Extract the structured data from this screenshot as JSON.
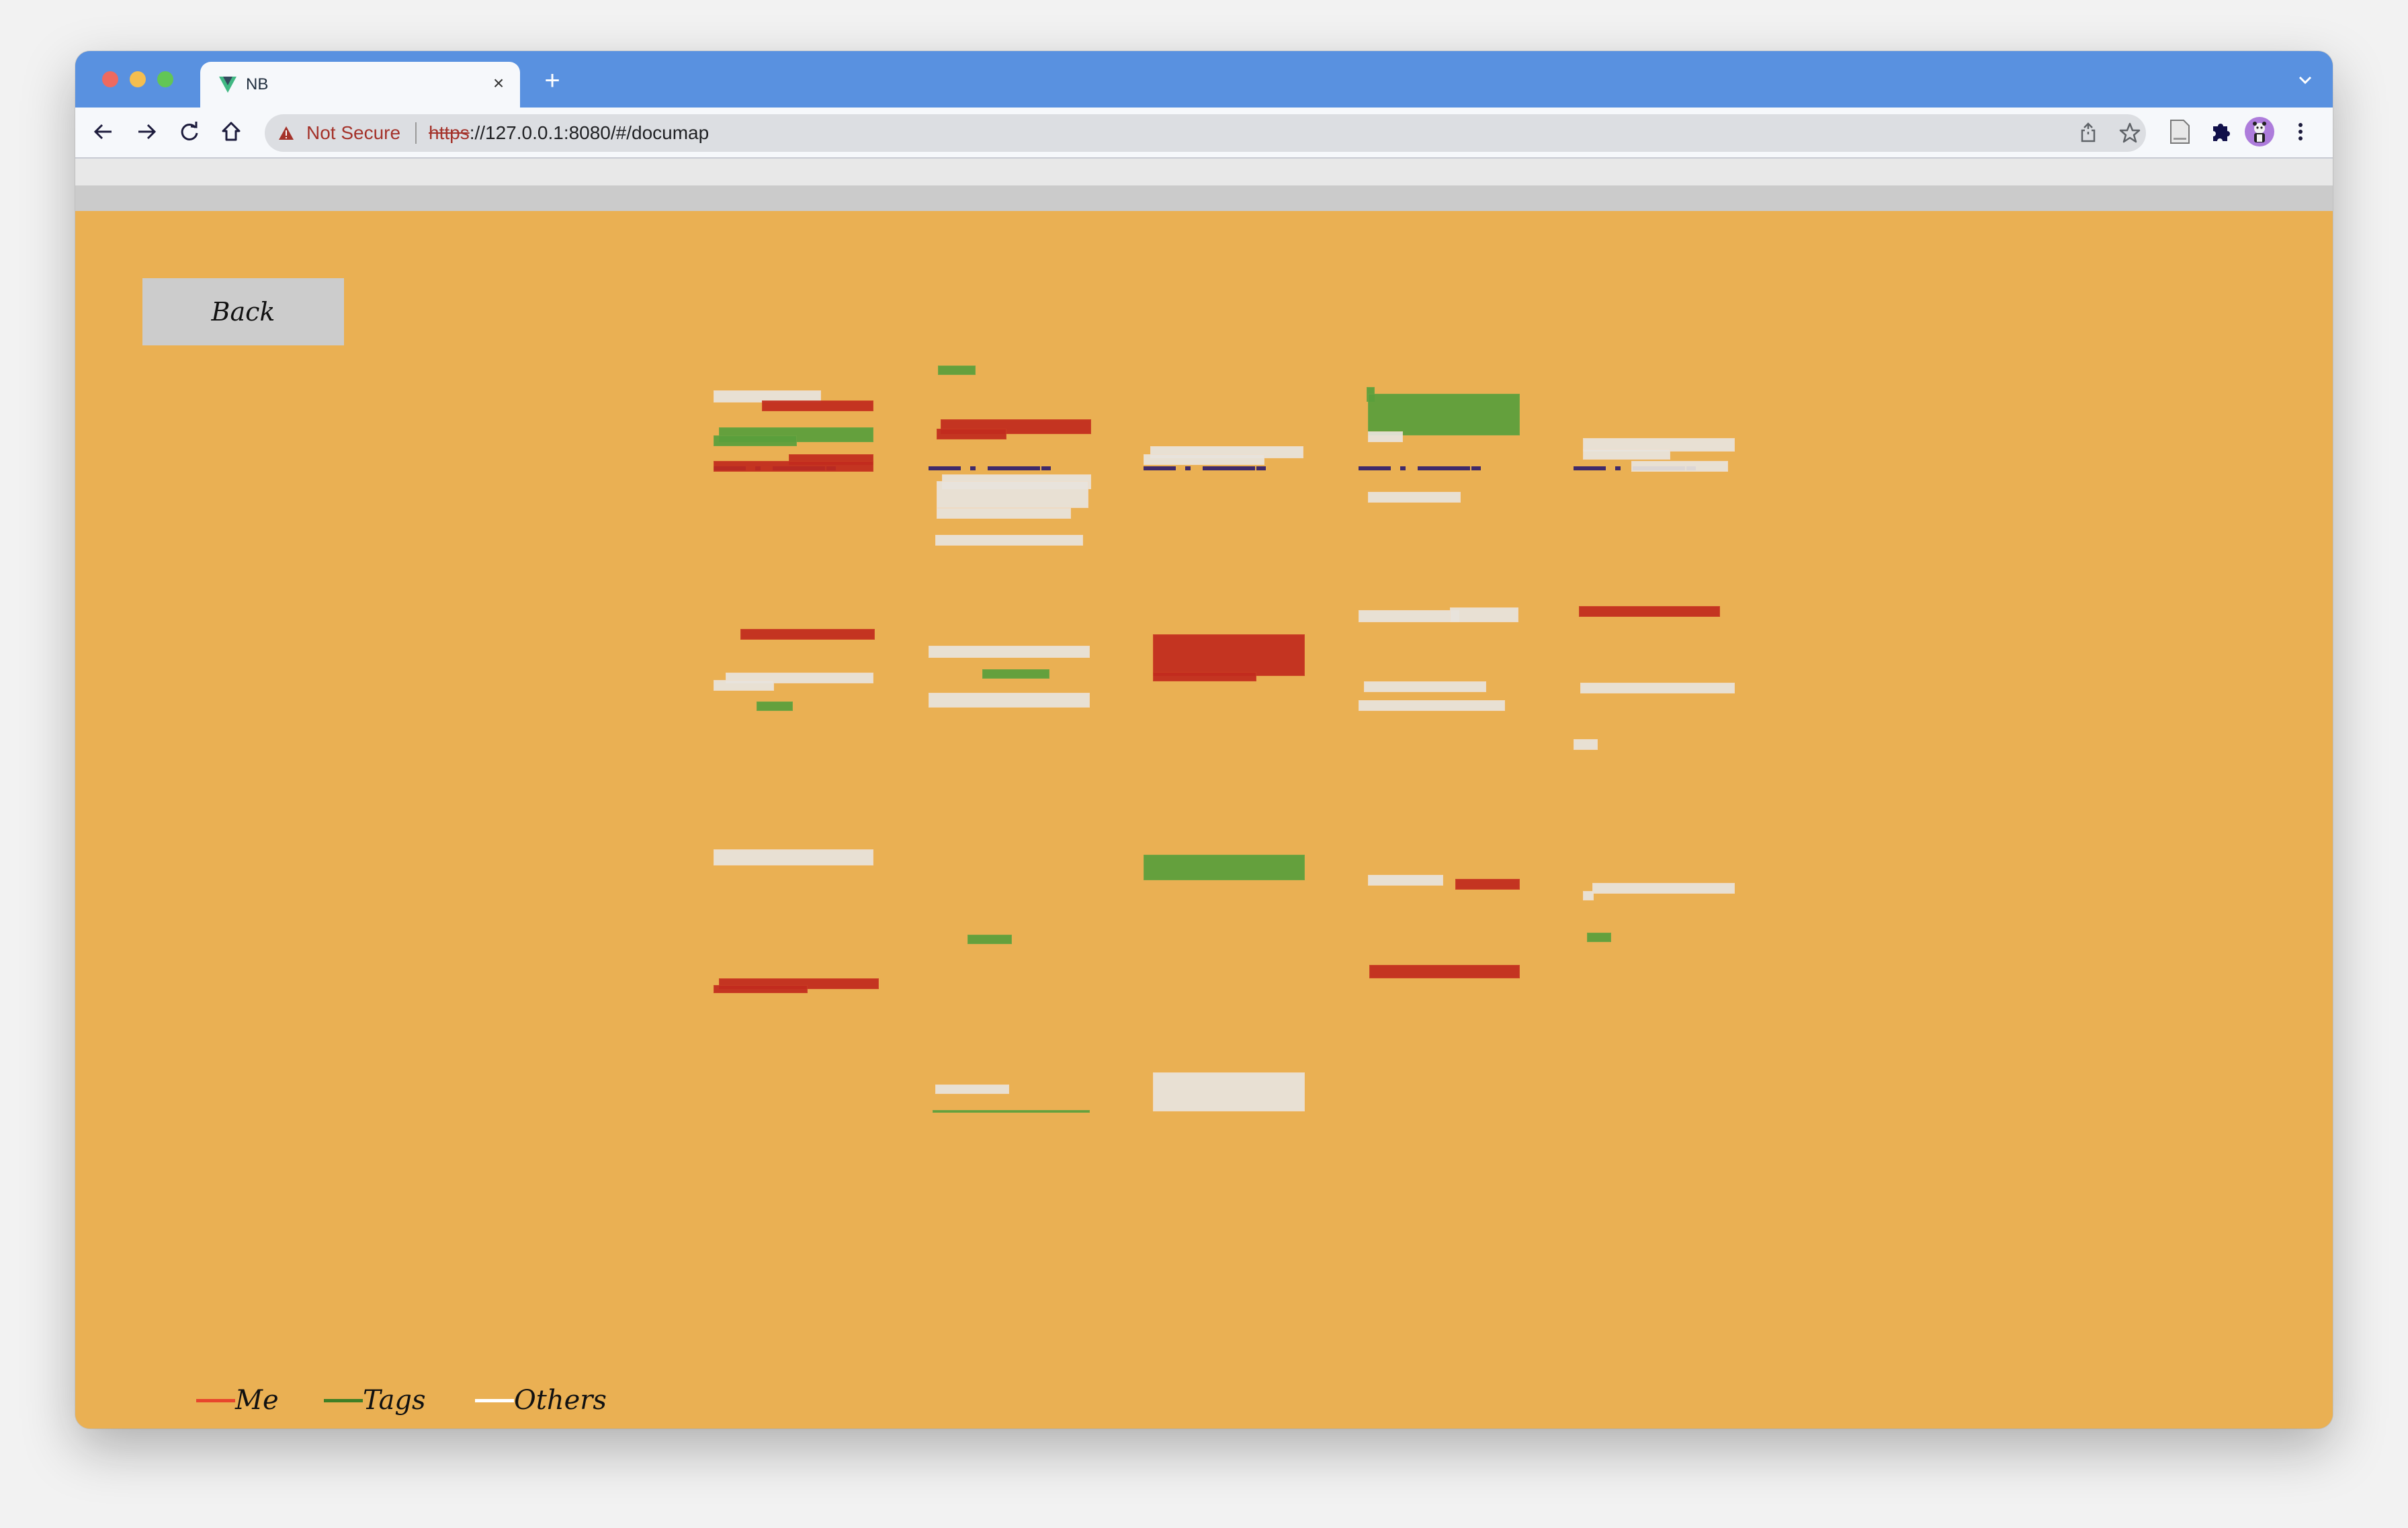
{
  "browser": {
    "tab_title": "NB",
    "tab_close": "×",
    "new_tab": "+",
    "security_label": "Not Secure",
    "url_scheme": "https",
    "url_rest": "://127.0.0.1:8080/#/documap",
    "url_host": "127.0.0.1",
    "icons": {
      "back": "arrow-left-icon",
      "forward": "arrow-right-icon",
      "reload": "reload-icon",
      "home": "home-icon",
      "share": "share-icon",
      "bookmark": "star-icon",
      "reading_list": "document-icon",
      "extensions": "puzzle-icon",
      "profile": "profile-avatar-icon",
      "menu": "kebab-menu-icon"
    }
  },
  "page": {
    "back_label": "Back",
    "colors": {
      "background": "#eab053",
      "me": "#c22b1e",
      "tags": "#5a9f3c",
      "others": "#e8e4dd",
      "header": "#3f2a6a"
    },
    "columns": [
      {
        "highlights": [
          "others",
          "me",
          "tags",
          "tags",
          "me",
          "me",
          "me",
          "others",
          "others",
          "tags",
          "others",
          "me",
          "me"
        ]
      },
      {
        "highlights": [
          "tags",
          "me",
          "me",
          "others",
          "others",
          "others",
          "others",
          "tags",
          "others",
          "others",
          "tags",
          "others",
          "tags"
        ]
      },
      {
        "highlights": [
          "others",
          "others",
          "me",
          "me",
          "tags",
          "others"
        ]
      },
      {
        "highlights": [
          "tags",
          "tags",
          "others",
          "others",
          "others",
          "others",
          "others",
          "others",
          "others",
          "me",
          "me"
        ]
      },
      {
        "highlights": [
          "others",
          "others",
          "others",
          "me",
          "others",
          "others",
          "others",
          "others",
          "tags"
        ]
      }
    ]
  },
  "legend": {
    "items": [
      {
        "label": "Me",
        "color": "#e8452c"
      },
      {
        "label": "Tags",
        "color": "#3f7f25"
      },
      {
        "label": "Others",
        "color": "#ffffff"
      }
    ]
  }
}
